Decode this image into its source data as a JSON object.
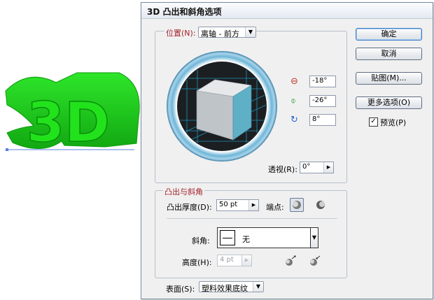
{
  "artwork": {
    "text": "3D"
  },
  "dialog": {
    "title": "3D 凸出和斜角选项",
    "position": {
      "label": "位置(N):",
      "value": "离轴 - 前方"
    },
    "rotation": {
      "x": "-18°",
      "y": "-26°",
      "z": "8°"
    },
    "perspective": {
      "label": "透视(R):",
      "value": "0°"
    },
    "extrude_section": {
      "heading": "凸出与斜角",
      "depth_label": "凸出厚度(D):",
      "depth_value": "50 pt",
      "cap_label": "端点:",
      "bevel_label": "斜角:",
      "bevel_value": "无",
      "height_label": "高度(H):",
      "height_value": "4 pt"
    },
    "surface": {
      "label": "表面(S):",
      "value": "塑料效果底纹"
    },
    "buttons": {
      "ok": "确定",
      "cancel": "取消",
      "map": "贴图(M)...",
      "more_options": "更多选项(O)",
      "preview": "预览(P)"
    },
    "preview_checked": true
  },
  "colors": {
    "extrude_green": "#1fd21a",
    "cube_front": "#58a9bf",
    "selection_line": "#5b7fe0"
  }
}
